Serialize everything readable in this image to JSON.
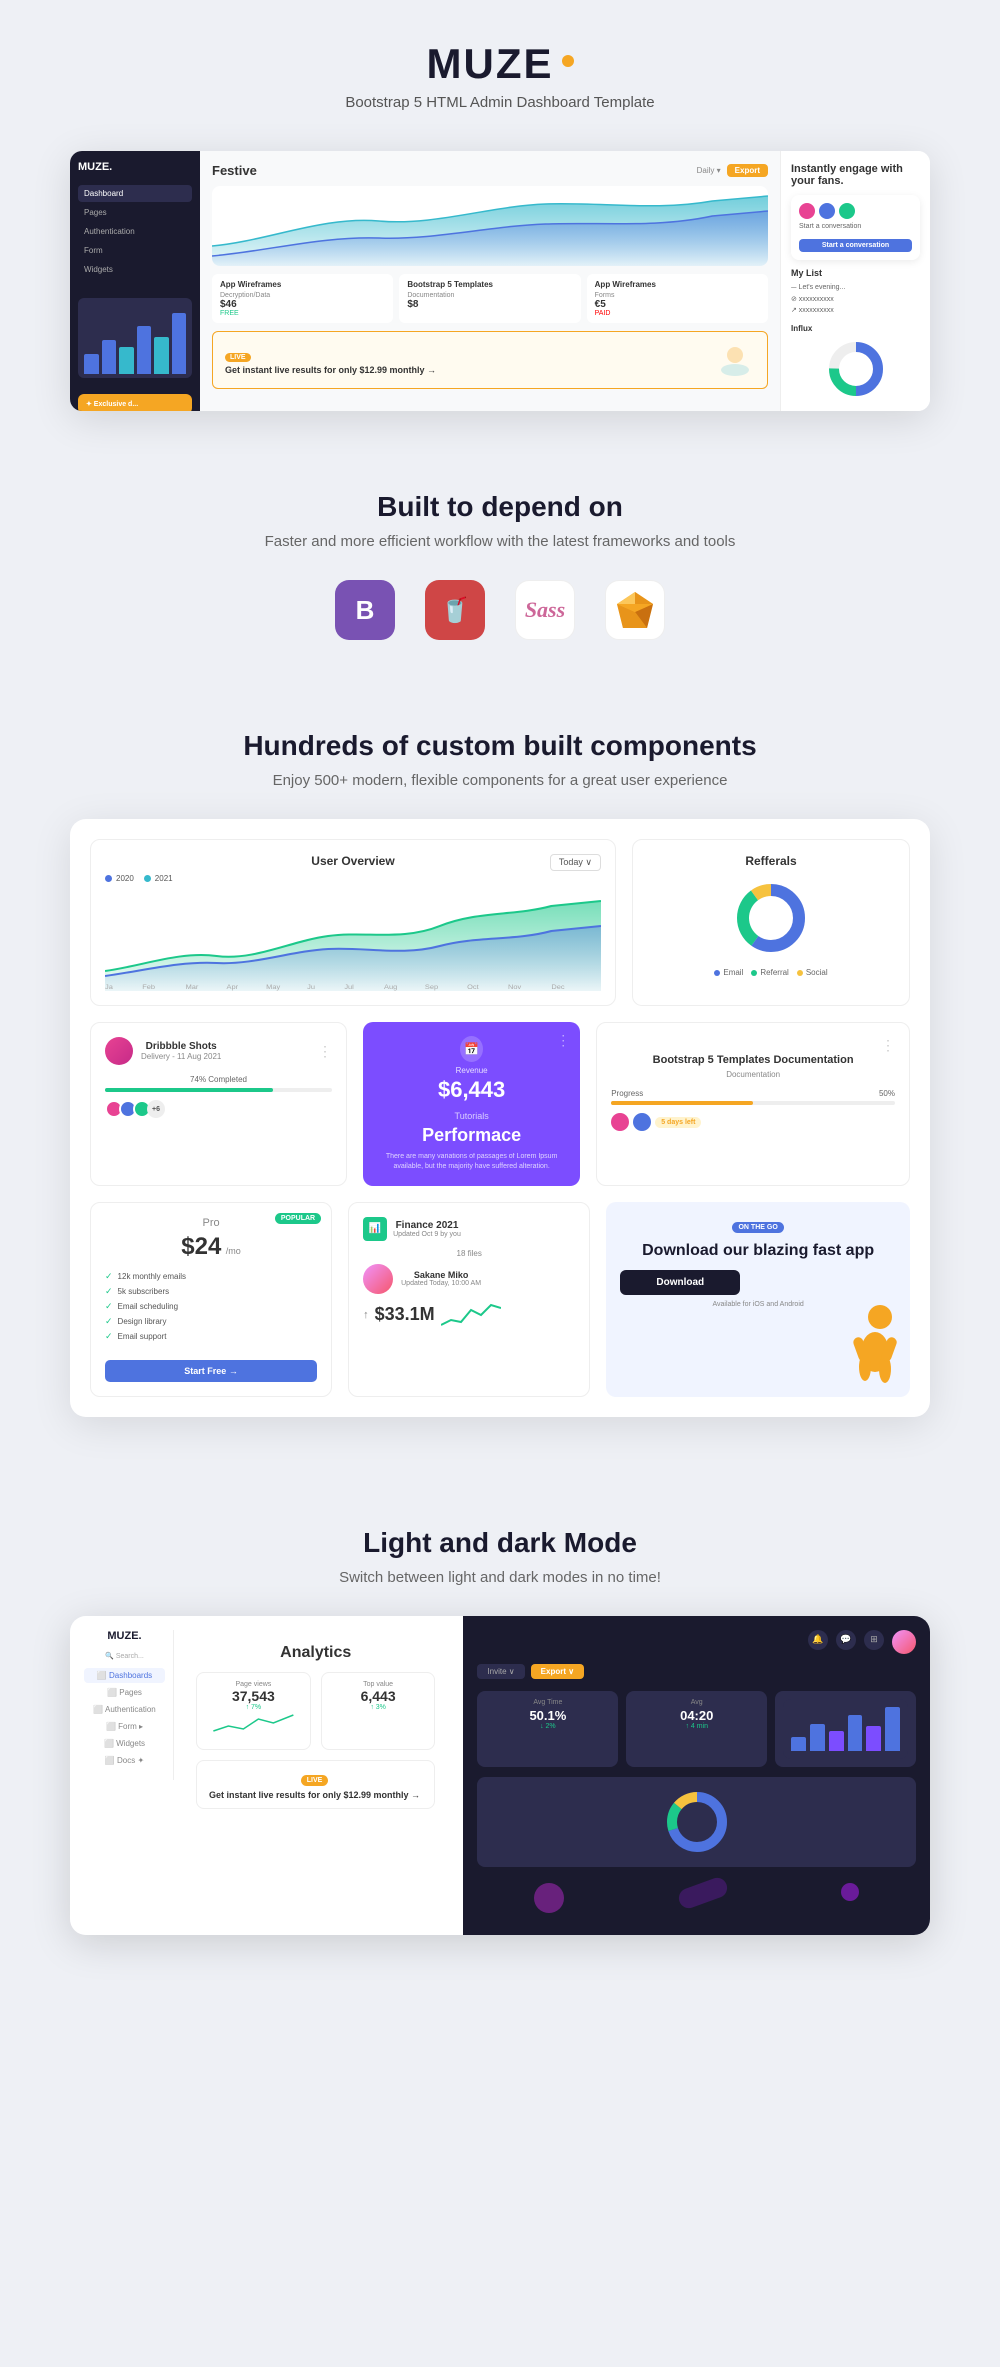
{
  "logo": {
    "text": "MUZE",
    "dot_color": "#f5a623"
  },
  "header": {
    "subtitle": "Bootstrap 5 HTML Admin Dashboard Template"
  },
  "section_built": {
    "title": "Built to depend on",
    "subtitle": "Faster and more efficient workflow with the latest frameworks and tools",
    "tech_icons": [
      {
        "name": "Bootstrap",
        "label": "B",
        "type": "bootstrap"
      },
      {
        "name": "Gulp",
        "label": "G",
        "type": "gulp"
      },
      {
        "name": "Sass",
        "label": "Sass",
        "type": "sass"
      },
      {
        "name": "Sketch",
        "label": "S",
        "type": "sketch"
      }
    ]
  },
  "section_components": {
    "title": "Hundreds of custom built components",
    "subtitle": "Enjoy 500+ modern, flexible components for a great user experience"
  },
  "dashboard": {
    "user_overview": {
      "title": "User Overview",
      "today_button": "Today ∨",
      "legend": [
        "2020",
        "2021"
      ]
    },
    "refferals": {
      "title": "Refferals",
      "legend": [
        "Email",
        "Referral",
        "Social"
      ]
    },
    "dribbble": {
      "name": "Dribbble Shots",
      "date": "Delivery - 11 Aug 2021",
      "progress": "74% Completed",
      "progress_pct": 74
    },
    "revenue_card": {
      "label": "Revenue",
      "amount": "$6,443",
      "tutorial_label": "Tutorials",
      "performance_title": "Performace",
      "body_text": "There are many variations of passages of Lorem Ipsum available, but the majority have suffered alteration."
    },
    "bootstrap_card": {
      "title": "Bootstrap 5 Templates Documentation",
      "progress_label": "Progress",
      "progress_pct": "50%",
      "days_badge": "5 days left"
    },
    "pro_plan": {
      "popular_badge": "POPULAR",
      "plan_name": "Pro",
      "price": "$24",
      "period": "/mo",
      "features": [
        "12k monthly emails",
        "5k subscribers",
        "Email scheduling",
        "Design library",
        "Email support"
      ],
      "cta": "Start Free →"
    },
    "finance": {
      "title": "Finance 2021",
      "subtitle": "Updated Oct 9 by you",
      "files_label": "18 files",
      "person_name": "Sakane Miko",
      "person_date": "Updated Today, 10:00 AM",
      "amount": "$33.1M"
    },
    "download_app": {
      "badge": "ON THE GO",
      "title": "Download our blazing fast app",
      "button": "Download",
      "stores": "Available for iOS and Android"
    }
  },
  "section_modes": {
    "title": "Light and dark Mode",
    "subtitle": "Switch between light and dark modes in no time!",
    "light_mode": {
      "logo": "MUZE.",
      "menu_items": [
        "Dashboards",
        "Pages",
        "Authentication",
        "Form ▸",
        "Widgets",
        "Docs ✦"
      ],
      "content_title": "Analytics",
      "stat1_label": "Page views",
      "stat1_value": "37,543",
      "stat1_sub": "↑ 7%",
      "stat2_label": "Top value",
      "stat2_value": "6,443",
      "stat2_sub": "↑ 3%",
      "promo_badge": "LIVE",
      "promo_text": "Get instant live results for only $12.99 monthly →"
    },
    "dark_mode": {
      "invite_btn": "Invite ∨",
      "export_btn": "Export ∨",
      "stat1_label": "Avg Time",
      "stat1_value": "50.1%",
      "stat1_sub": "↓ 2%",
      "stat2_label": "Avg",
      "stat2_value": "04:20",
      "stat2_sub": "↑ 4 min"
    }
  }
}
